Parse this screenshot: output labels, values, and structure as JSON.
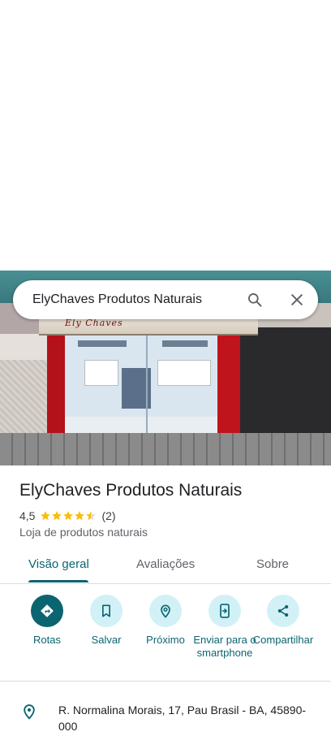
{
  "search": {
    "value": "ElyChaves Produtos Naturais"
  },
  "photo": {
    "awning_text": "Ely Chaves"
  },
  "place": {
    "title": "ElyChaves Produtos Naturais",
    "rating": "4,5",
    "stars": 4.5,
    "reviews_count": "(2)",
    "category": "Loja de produtos naturais"
  },
  "tabs": [
    {
      "label": "Visão geral",
      "active": true
    },
    {
      "label": "Avaliações",
      "active": false
    },
    {
      "label": "Sobre",
      "active": false
    }
  ],
  "actions": [
    {
      "label": "Rotas",
      "icon": "directions-icon"
    },
    {
      "label": "Salvar",
      "icon": "bookmark-icon"
    },
    {
      "label": "Próximo",
      "icon": "nearby-icon"
    },
    {
      "label": "Enviar para o smartphone",
      "icon": "send-to-phone-icon"
    },
    {
      "label": "Compartilhar",
      "icon": "share-icon"
    }
  ],
  "address": {
    "text": "R. Normalina Morais, 17, Pau Brasil - BA, 45890-000"
  },
  "colors": {
    "accent": "#0b6570",
    "accent_light": "#d2f1f6",
    "star": "#fbbc04"
  }
}
